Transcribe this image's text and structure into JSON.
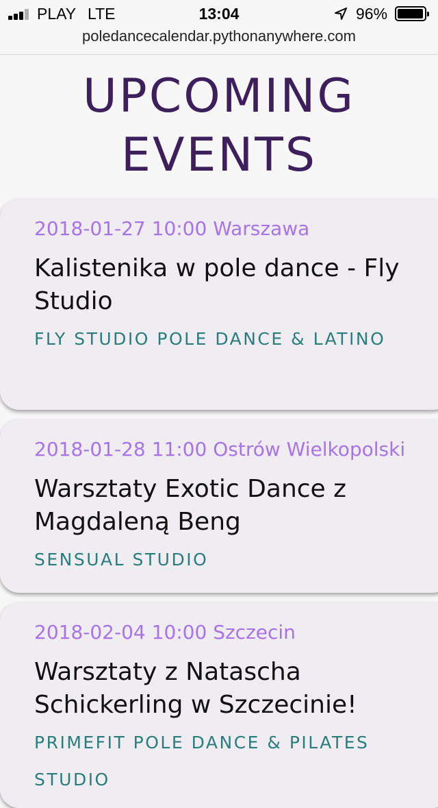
{
  "status_bar": {
    "carrier": "PLAY",
    "network": "LTE",
    "time": "13:04",
    "battery": "96%",
    "battery_level": 0.96,
    "signal_bars": 3
  },
  "browser": {
    "url": "poledancecalendar.pythonanywhere.com"
  },
  "page": {
    "title_line1": "UPCOMING",
    "title_line2": "EVENTS"
  },
  "events": [
    {
      "meta": "2018-01-27 10:00 Warszawa",
      "title": "Kalistenika w pole dance - Fly Studio",
      "studio": "FLY STUDIO POLE DANCE & LATINO"
    },
    {
      "meta": "2018-01-28 11:00 Ostrów Wielkopolski",
      "title": "Warsztaty Exotic Dance z Magdaleną Beng",
      "studio": "SENSUAL STUDIO"
    },
    {
      "meta": "2018-02-04 10:00 Szczecin",
      "title": "Warsztaty z Natascha Schickerling w Szczecinie!",
      "studio": "PRIMEFIT POLE DANCE & PILATES STUDIO"
    }
  ],
  "colors": {
    "title": "#3d1f5c",
    "meta": "#a873e8",
    "studio": "#2b7d7d",
    "card_bg": "#efedf1"
  }
}
